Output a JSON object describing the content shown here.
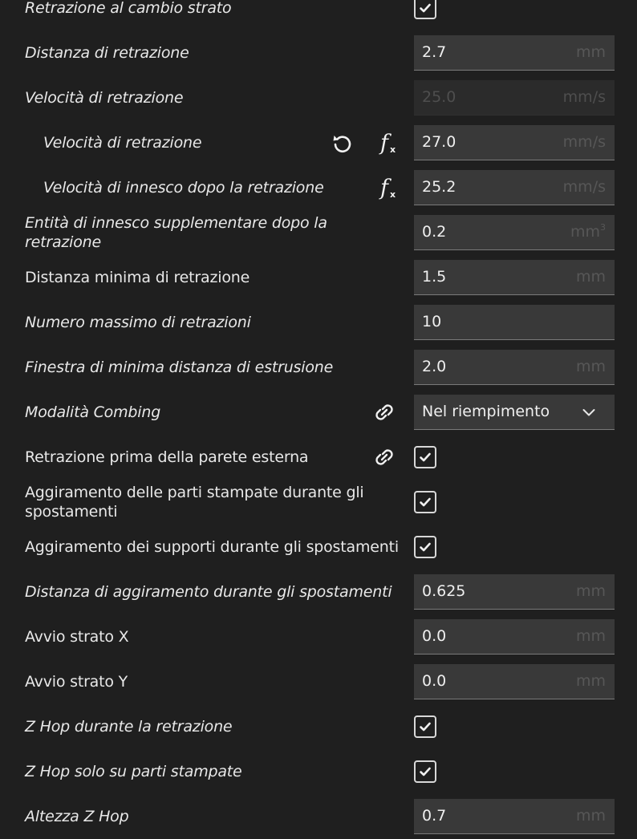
{
  "settings": [
    {
      "label": "Retrazione al cambio strato",
      "italic": true,
      "control": "checkbox",
      "checked": true
    },
    {
      "label": "Distanza di retrazione",
      "italic": true,
      "control": "input",
      "value": "2.7",
      "unit": "mm"
    },
    {
      "label": "Velocità di retrazione",
      "italic": true,
      "control": "input",
      "value": "25.0",
      "unit": "mm/s",
      "disabled": true
    },
    {
      "label": "Velocità di retrazione",
      "italic": true,
      "indent": true,
      "control": "input",
      "value": "27.0",
      "unit": "mm/s",
      "reset_icon": true,
      "fx_icon": true
    },
    {
      "label": "Velocità di innesco dopo la retrazione",
      "italic": true,
      "indent": true,
      "control": "input",
      "value": "25.2",
      "unit": "mm/s",
      "fx_icon": true
    },
    {
      "label": "Entità di innesco supplementare dopo la retrazione",
      "italic": true,
      "control": "input",
      "value": "0.2",
      "unit": "mm",
      "unit_sup": "3"
    },
    {
      "label": "Distanza minima di retrazione",
      "italic": false,
      "control": "input",
      "value": "1.5",
      "unit": "mm"
    },
    {
      "label": "Numero massimo di retrazioni",
      "italic": true,
      "control": "input",
      "value": "10",
      "unit": ""
    },
    {
      "label": "Finestra di minima distanza di estrusione",
      "italic": true,
      "control": "input",
      "value": "2.0",
      "unit": "mm"
    },
    {
      "label": "Modalità Combing",
      "italic": true,
      "control": "select",
      "value": "Nel riempimento",
      "link_icon": true
    },
    {
      "label": "Retrazione prima della parete esterna",
      "italic": false,
      "control": "checkbox",
      "checked": true,
      "link_icon": true
    },
    {
      "label": "Aggiramento delle parti stampate durante gli spostamenti",
      "italic": false,
      "control": "checkbox",
      "checked": true
    },
    {
      "label": "Aggiramento dei supporti durante gli spostamenti",
      "italic": false,
      "control": "checkbox",
      "checked": true
    },
    {
      "label": "Distanza di aggiramento durante gli spostamenti",
      "italic": true,
      "control": "input",
      "value": "0.625",
      "unit": "mm"
    },
    {
      "label": "Avvio strato X",
      "italic": false,
      "control": "input",
      "value": "0.0",
      "unit": "mm"
    },
    {
      "label": "Avvio strato Y",
      "italic": false,
      "control": "input",
      "value": "0.0",
      "unit": "mm"
    },
    {
      "label": "Z Hop durante la retrazione",
      "italic": true,
      "control": "checkbox",
      "checked": true
    },
    {
      "label": "Z Hop solo su parti stampate",
      "italic": true,
      "control": "checkbox",
      "checked": true
    },
    {
      "label": "Altezza Z Hop",
      "italic": true,
      "control": "input",
      "value": "0.7",
      "unit": "mm"
    }
  ],
  "icons": {
    "reset": "reset-icon",
    "fx": "function-icon",
    "link": "link-icon",
    "check": "checkmark-icon",
    "chevron": "chevron-down-icon"
  },
  "colors": {
    "background": "#1f1f1f",
    "field": "#393939",
    "text": "#e7e7e7",
    "unit": "#575757"
  }
}
